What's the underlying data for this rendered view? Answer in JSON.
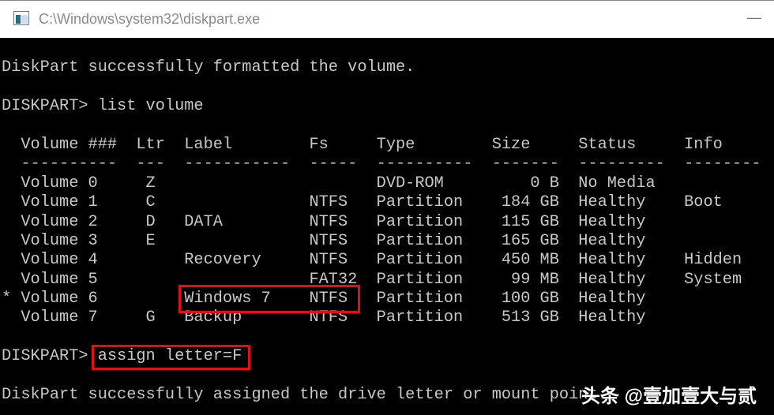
{
  "window": {
    "title": "C:\\Windows\\system32\\diskpart.exe",
    "minimize_icon": "minimize-icon"
  },
  "console": {
    "lines": [
      "",
      "DiskPart successfully formatted the volume.",
      "",
      "DISKPART> list volume",
      "",
      "  Volume ###  Ltr  Label        Fs     Type        Size     Status     Info",
      "  ----------  ---  -----------  -----  ----------  -------  ---------  --------",
      "  Volume 0     Z                       DVD-ROM         0 B  No Media",
      "  Volume 1     C                NTFS   Partition    184 GB  Healthy    Boot",
      "  Volume 2     D   DATA         NTFS   Partition    115 GB  Healthy",
      "  Volume 3     E                NTFS   Partition    165 GB  Healthy",
      "  Volume 4         Recovery     NTFS   Partition    450 MB  Healthy    Hidden",
      "  Volume 5                      FAT32  Partition     99 MB  Healthy    System",
      "* Volume 6         Windows 7    NTFS   Partition    100 GB  Healthy",
      "  Volume 7     G   Backup       NTFS   Partition    513 GB  Healthy",
      "",
      "DISKPART> assign letter=F",
      "",
      "DiskPart successfully assigned the drive letter or mount point."
    ]
  },
  "highlight_color": "#e01010",
  "watermark": "头条 @壹加壹大与贰"
}
